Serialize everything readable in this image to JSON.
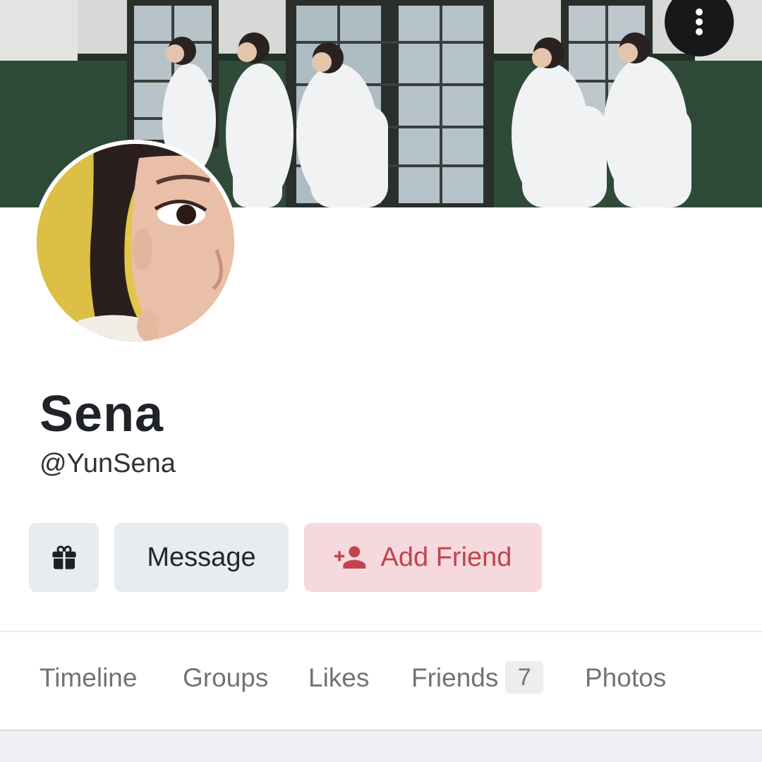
{
  "profile": {
    "display_name": "Sena",
    "handle": "@YunSena",
    "cover_image": "cover-photo",
    "avatar_image": "avatar-photo"
  },
  "header": {
    "more_icon": "more-vertical-icon"
  },
  "actions": {
    "gift_icon": "gift-icon",
    "message_label": "Message",
    "add_friend_icon": "person-add-icon",
    "add_friend_label": "Add Friend"
  },
  "tabs": [
    {
      "label": "Timeline"
    },
    {
      "label": "Groups"
    },
    {
      "label": "Likes"
    },
    {
      "label": "Friends",
      "count": "7"
    },
    {
      "label": "Photos"
    }
  ],
  "colors": {
    "add_friend_bg": "#f5d9dd",
    "add_friend_text": "#c2434d",
    "neutral_button_bg": "#e9ecee",
    "tab_text": "#707479"
  }
}
